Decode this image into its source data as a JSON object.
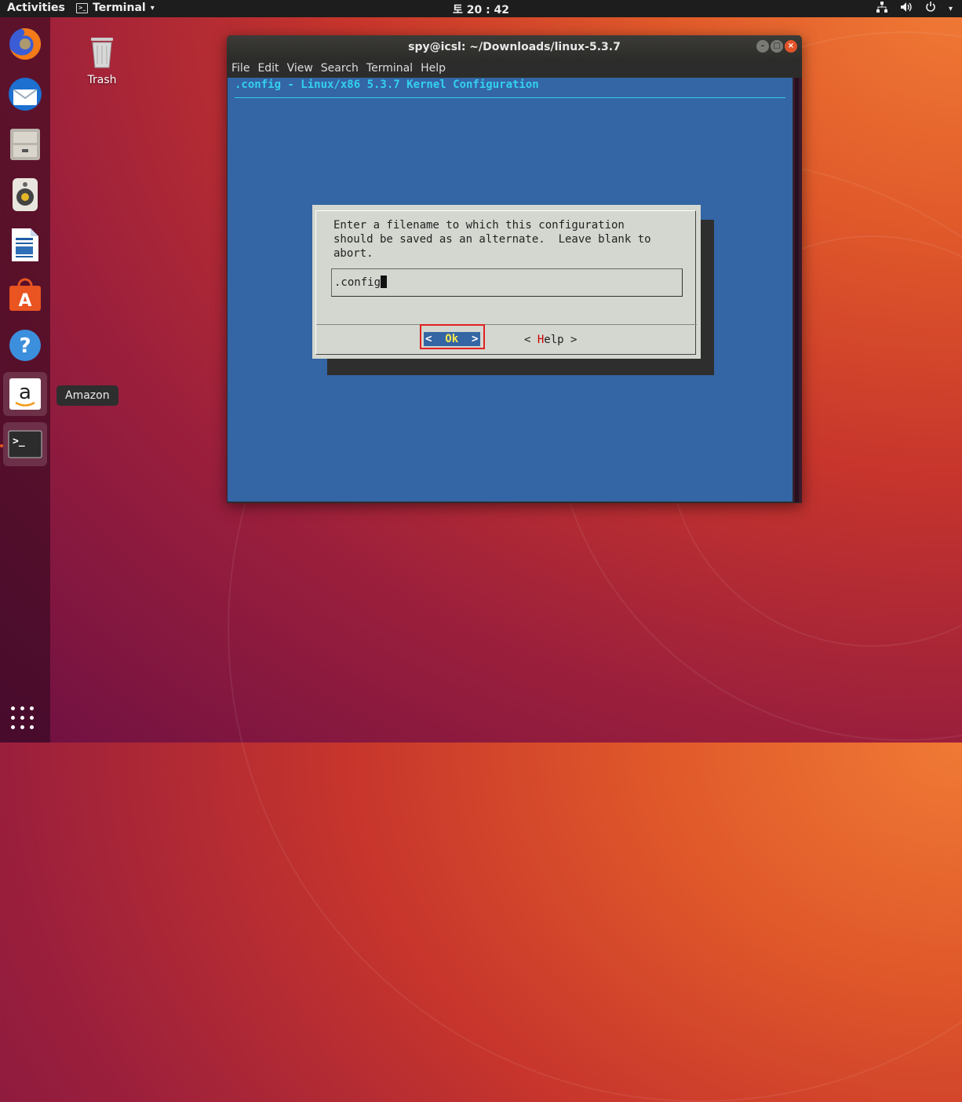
{
  "topbar": {
    "activities": "Activities",
    "app_menu": "Terminal",
    "clock": "토 20 : 42"
  },
  "dock": {
    "items": [
      "firefox-icon",
      "thunderbird-icon",
      "files-icon",
      "rhythmbox-icon",
      "writer-icon",
      "software-icon",
      "help-icon",
      "amazon-icon",
      "terminal-icon"
    ],
    "tooltip": "Amazon"
  },
  "desktop": {
    "trash_label": "Trash"
  },
  "window": {
    "title": "spy@icsl: ~/Downloads/linux-5.3.7",
    "menus": [
      "File",
      "Edit",
      "View",
      "Search",
      "Terminal",
      "Help"
    ]
  },
  "terminal": {
    "config_title": ".config - Linux/x86 5.3.7 Kernel Configuration",
    "dialog": {
      "line1": "Enter a filename to which this configuration",
      "line2": "should be saved as an alternate.  Leave blank to",
      "line3": "abort.",
      "input_value": ".config",
      "ok_left": "<  ",
      "ok_key": "Ok",
      "ok_right": "  >",
      "help_left": "< ",
      "help_key": "H",
      "help_rest": "elp >"
    }
  },
  "colors": {
    "term_bg": "#3465a4",
    "dialog_bg": "#d3d7cf",
    "accent": "#e95420"
  }
}
